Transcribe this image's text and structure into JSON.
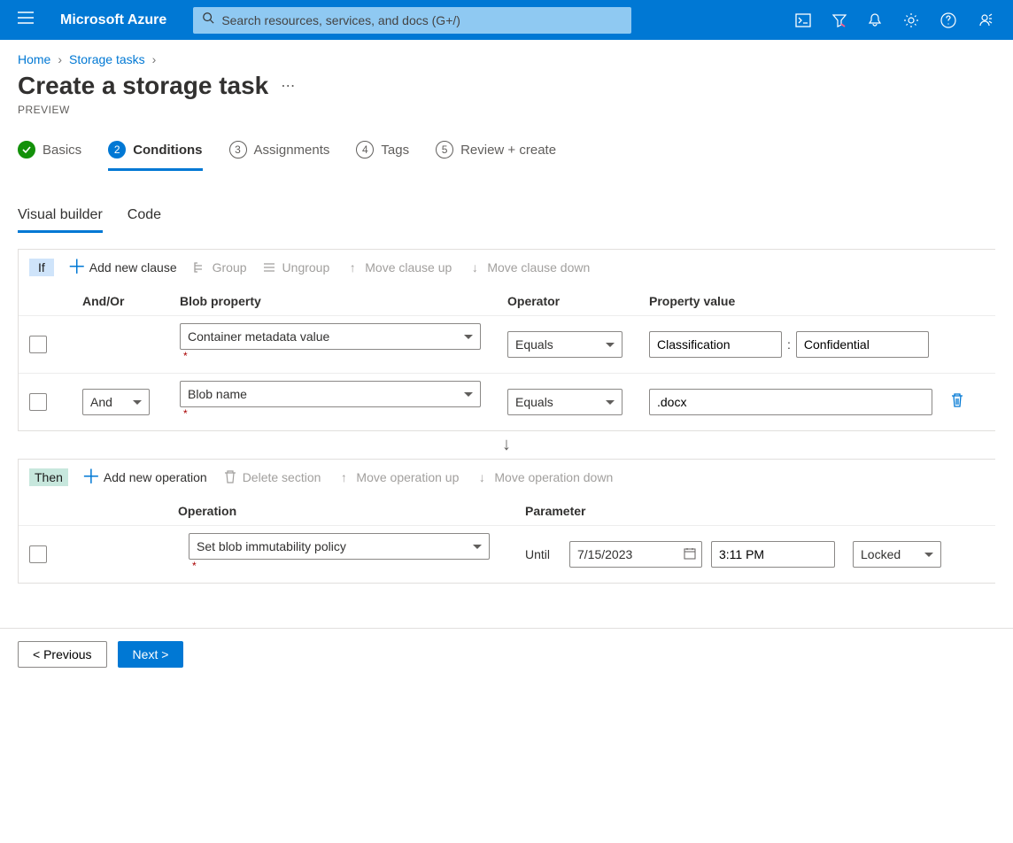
{
  "topbar": {
    "brand": "Microsoft Azure",
    "search_placeholder": "Search resources, services, and docs (G+/)"
  },
  "breadcrumb": {
    "home": "Home",
    "storage_tasks": "Storage tasks"
  },
  "page": {
    "title": "Create a storage task",
    "subtitle": "PREVIEW"
  },
  "steps": [
    {
      "label": "Basics",
      "state": "done"
    },
    {
      "label": "Conditions",
      "state": "active",
      "num": "2"
    },
    {
      "label": "Assignments",
      "state": "pending",
      "num": "3"
    },
    {
      "label": "Tags",
      "state": "pending",
      "num": "4"
    },
    {
      "label": "Review + create",
      "state": "pending",
      "num": "5"
    }
  ],
  "subtabs": {
    "visual": "Visual builder",
    "code": "Code"
  },
  "if_toolbar": {
    "tag": "If",
    "add": "Add new clause",
    "group": "Group",
    "ungroup": "Ungroup",
    "move_up": "Move clause up",
    "move_down": "Move clause down"
  },
  "cond_headers": {
    "andor": "And/Or",
    "prop": "Blob property",
    "op": "Operator",
    "val": "Property value"
  },
  "conditions": [
    {
      "andor": "",
      "property": "Container metadata value",
      "operator": "Equals",
      "value_key": "Classification",
      "value_val": "Confidential",
      "split": true
    },
    {
      "andor": "And",
      "property": "Blob name",
      "operator": "Equals",
      "value": ".docx",
      "split": false,
      "deletable": true
    }
  ],
  "then_toolbar": {
    "tag": "Then",
    "add": "Add new operation",
    "delete": "Delete section",
    "move_up": "Move operation up",
    "move_down": "Move operation down"
  },
  "op_headers": {
    "operation": "Operation",
    "parameter": "Parameter"
  },
  "operations": [
    {
      "op": "Set blob immutability policy",
      "until_label": "Until",
      "date": "7/15/2023",
      "time": "3:11 PM",
      "lock": "Locked"
    }
  ],
  "footer": {
    "prev": "< Previous",
    "next": "Next >"
  }
}
